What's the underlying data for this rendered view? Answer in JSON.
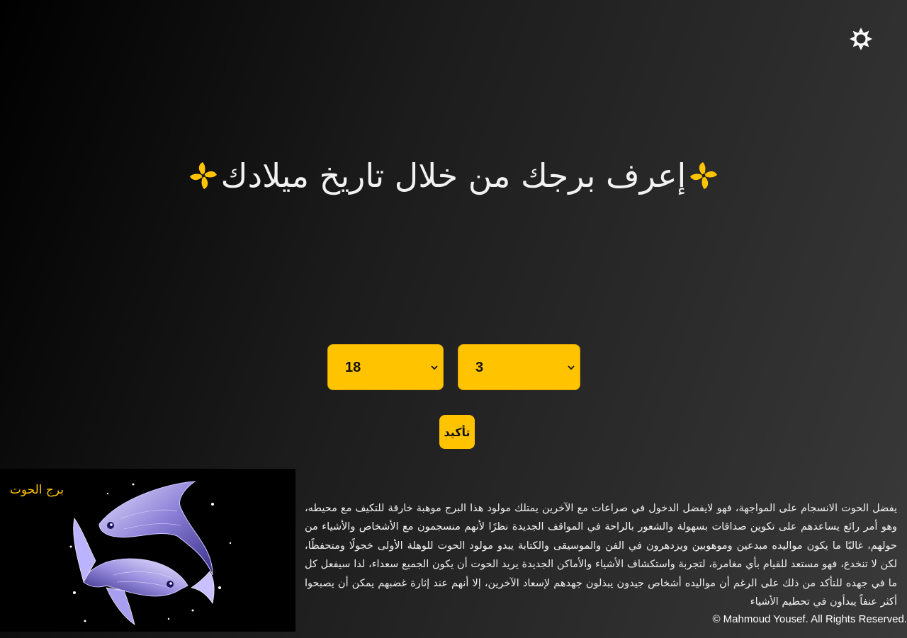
{
  "theme_toggle": {
    "icon": "sun-icon"
  },
  "header": {
    "title": "إعرف برجك من خلال تاريخ ميلادك",
    "decor_icon": "pinwheel-icon",
    "decor_color": "#ffc300"
  },
  "form": {
    "day_select": {
      "value": "18"
    },
    "month_select": {
      "value": "3"
    },
    "confirm_label": "تأكيد",
    "accent_color": "#ffc300"
  },
  "result": {
    "sign_name": "برج الحوت",
    "image_alt": "pisces-fish-illustration",
    "description": "يفضل الحوت الانسجام على المواجهة، فهو لايفضل الدخول في صراعات مع الآخرين يمتلك مولود هذا البرج موهبة خارقة للتكيف مع محيطه، وهو أمر رائع يساعدهم على تكوين صداقات بسهولة والشعور بالراحة في المواقف الجديدة نظرًا لأنهم منسجمون مع الأشخاص والأشياء من حولهم، غالبًا ما يكون مواليده مبدعين وموهوبين ويزدهرون في الفن والموسيقى والكتابة يبدو مولود الحوت للوهلة الأولى خجولًا ومتحفظًا، لكن لا تنخدع، فهو مستعد للقيام بأي مغامرة، لتجربة واستكشاف الأشياء والأماكن الجديدة يريد الحوت أن يكون الجميع سعداء، لذا سيفعل كل ما في جهده للتأكد من ذلك على الرغم أن مواليده أشخاص جيدون يبذلون جهدهم لإسعاد الآخرين، إلا أنهم عند إثارة غضبهم يمكن أن يصبحوا أكثر عنفاً يبدأون في تحطيم الأشياء"
  },
  "footer": {
    "copyright": "© Mahmoud Yousef. All Rights Reserved."
  }
}
